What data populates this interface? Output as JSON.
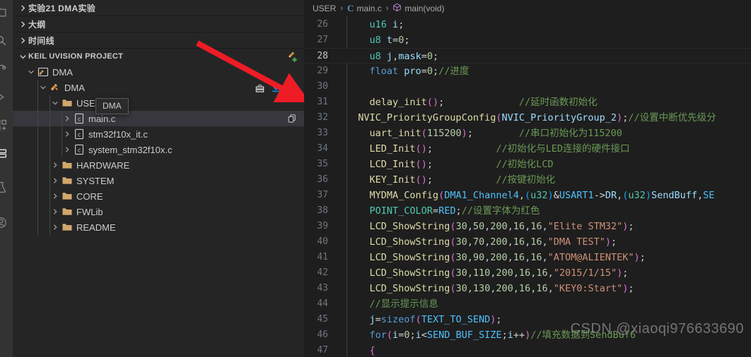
{
  "activity_bar": {
    "items": [
      {
        "name": "explorer-icon",
        "selected": false
      },
      {
        "name": "search-icon",
        "selected": false
      },
      {
        "name": "source-control-icon",
        "selected": false
      },
      {
        "name": "run-debug-icon",
        "selected": false
      },
      {
        "name": "extensions-icon",
        "selected": false
      },
      {
        "name": "remote-explorer-icon",
        "selected": true
      },
      {
        "name": "test-icon",
        "selected": false
      },
      {
        "name": "account-icon",
        "selected": false
      }
    ]
  },
  "sidebar": {
    "sections": [
      {
        "label": "实验21 DMA实验",
        "expanded": false,
        "cjk": true
      },
      {
        "label": "大纲",
        "expanded": false,
        "cjk": true
      },
      {
        "label": "时间线",
        "expanded": false,
        "cjk": true
      },
      {
        "label": "KEIL UVISION PROJECT",
        "expanded": true,
        "cjk": false,
        "action": "add-project-icon"
      }
    ],
    "tree": [
      {
        "label": "DMA",
        "depth": 0,
        "kind": "workspace",
        "expanded": true,
        "selected": false
      },
      {
        "label": "DMA",
        "depth": 1,
        "kind": "project",
        "expanded": true,
        "selected": false,
        "actions": [
          "build-icon",
          "download-icon",
          "rebuild-icon"
        ]
      },
      {
        "label": "USER",
        "depth": 2,
        "kind": "folder",
        "expanded": true,
        "selected": false
      },
      {
        "label": "main.c",
        "depth": 3,
        "kind": "cfile",
        "expanded": false,
        "selected": true,
        "row_action": "copy-icon"
      },
      {
        "label": "stm32f10x_it.c",
        "depth": 3,
        "kind": "cfile",
        "expanded": false,
        "selected": false
      },
      {
        "label": "system_stm32f10x.c",
        "depth": 3,
        "kind": "cfile",
        "expanded": false,
        "selected": false
      },
      {
        "label": "HARDWARE",
        "depth": 2,
        "kind": "folder",
        "expanded": false,
        "selected": false
      },
      {
        "label": "SYSTEM",
        "depth": 2,
        "kind": "folder",
        "expanded": false,
        "selected": false
      },
      {
        "label": "CORE",
        "depth": 2,
        "kind": "folder",
        "expanded": false,
        "selected": false
      },
      {
        "label": "FWLib",
        "depth": 2,
        "kind": "folder",
        "expanded": false,
        "selected": false
      },
      {
        "label": "README",
        "depth": 2,
        "kind": "folder",
        "expanded": false,
        "selected": false
      }
    ],
    "tooltip": "DMA"
  },
  "breadcrumb": {
    "folder": "USER",
    "file": "main.c",
    "symbol": "main(void)",
    "separator": "›"
  },
  "editor": {
    "first_line": 26,
    "current_line": 28,
    "lines": [
      {
        "n": "26",
        "tokens": [
          {
            "t": "    ",
            "c": "t-op"
          },
          {
            "t": "u16",
            "c": "t-type"
          },
          {
            "t": " ",
            "c": "t-op"
          },
          {
            "t": "i",
            "c": "t-var"
          },
          {
            "t": ";",
            "c": "t-punc"
          }
        ]
      },
      {
        "n": "27",
        "tokens": [
          {
            "t": "    ",
            "c": "t-op"
          },
          {
            "t": "u8",
            "c": "t-type"
          },
          {
            "t": " ",
            "c": "t-op"
          },
          {
            "t": "t",
            "c": "t-var"
          },
          {
            "t": "=",
            "c": "t-op"
          },
          {
            "t": "0",
            "c": "t-num"
          },
          {
            "t": ";",
            "c": "t-punc"
          }
        ]
      },
      {
        "n": "28",
        "tokens": [
          {
            "t": "    ",
            "c": "t-op"
          },
          {
            "t": "u8",
            "c": "t-type"
          },
          {
            "t": " ",
            "c": "t-op"
          },
          {
            "t": "j",
            "c": "t-var"
          },
          {
            "t": ",",
            "c": "t-punc"
          },
          {
            "t": "mask",
            "c": "t-var"
          },
          {
            "t": "=",
            "c": "t-op"
          },
          {
            "t": "0",
            "c": "t-num"
          },
          {
            "t": ";",
            "c": "t-punc"
          }
        ]
      },
      {
        "n": "29",
        "tokens": [
          {
            "t": "    ",
            "c": "t-op"
          },
          {
            "t": "float",
            "c": "t-kw"
          },
          {
            "t": " ",
            "c": "t-op"
          },
          {
            "t": "pro",
            "c": "t-var"
          },
          {
            "t": "=",
            "c": "t-op"
          },
          {
            "t": "0",
            "c": "t-num"
          },
          {
            "t": ";",
            "c": "t-punc"
          },
          {
            "t": "//进度",
            "c": "t-cmt"
          }
        ]
      },
      {
        "n": "30",
        "tokens": [
          {
            "t": "",
            "c": "t-op"
          }
        ]
      },
      {
        "n": "31",
        "tokens": [
          {
            "t": "    ",
            "c": "t-op"
          },
          {
            "t": "delay_init",
            "c": "t-fn"
          },
          {
            "t": "(",
            "c": "t-paren"
          },
          {
            "t": ")",
            "c": "t-paren"
          },
          {
            "t": ";",
            "c": "t-punc"
          },
          {
            "t": "             //延时函数初始化",
            "c": "t-cmt"
          }
        ]
      },
      {
        "n": "32",
        "tokens": [
          {
            "t": "  ",
            "c": "t-op"
          },
          {
            "t": "NVIC_PriorityGroupConfig",
            "c": "t-fn"
          },
          {
            "t": "(",
            "c": "t-paren"
          },
          {
            "t": "NVIC_PriorityGroup_2",
            "c": "t-var"
          },
          {
            "t": ")",
            "c": "t-paren"
          },
          {
            "t": ";",
            "c": "t-punc"
          },
          {
            "t": "//设置中断优先级分",
            "c": "t-cmt"
          }
        ]
      },
      {
        "n": "33",
        "tokens": [
          {
            "t": "    ",
            "c": "t-op"
          },
          {
            "t": "uart_init",
            "c": "t-fn"
          },
          {
            "t": "(",
            "c": "t-paren"
          },
          {
            "t": "115200",
            "c": "t-num"
          },
          {
            "t": ")",
            "c": "t-paren"
          },
          {
            "t": ";",
            "c": "t-punc"
          },
          {
            "t": "        //串口初始化为115200",
            "c": "t-cmt"
          }
        ]
      },
      {
        "n": "34",
        "tokens": [
          {
            "t": "    ",
            "c": "t-op"
          },
          {
            "t": "LED_Init",
            "c": "t-fn"
          },
          {
            "t": "(",
            "c": "t-paren"
          },
          {
            "t": ")",
            "c": "t-paren"
          },
          {
            "t": ";",
            "c": "t-punc"
          },
          {
            "t": "           //初始化与LED连接的硬件接口",
            "c": "t-cmt"
          }
        ]
      },
      {
        "n": "35",
        "tokens": [
          {
            "t": "    ",
            "c": "t-op"
          },
          {
            "t": "LCD_Init",
            "c": "t-fn"
          },
          {
            "t": "(",
            "c": "t-paren"
          },
          {
            "t": ")",
            "c": "t-paren"
          },
          {
            "t": ";",
            "c": "t-punc"
          },
          {
            "t": "           //初始化LCD",
            "c": "t-cmt"
          }
        ]
      },
      {
        "n": "36",
        "tokens": [
          {
            "t": "    ",
            "c": "t-op"
          },
          {
            "t": "KEY_Init",
            "c": "t-fn"
          },
          {
            "t": "(",
            "c": "t-paren"
          },
          {
            "t": ")",
            "c": "t-paren"
          },
          {
            "t": ";",
            "c": "t-punc"
          },
          {
            "t": "           //按键初始化",
            "c": "t-cmt"
          }
        ]
      },
      {
        "n": "37",
        "tokens": [
          {
            "t": "    ",
            "c": "t-op"
          },
          {
            "t": "MYDMA_Config",
            "c": "t-fn"
          },
          {
            "t": "(",
            "c": "t-paren"
          },
          {
            "t": "DMA1_Channel4",
            "c": "t-const"
          },
          {
            "t": ",",
            "c": "t-punc"
          },
          {
            "t": "(",
            "c": "t-paren2"
          },
          {
            "t": "u32",
            "c": "t-type"
          },
          {
            "t": ")",
            "c": "t-paren2"
          },
          {
            "t": "&",
            "c": "t-op"
          },
          {
            "t": "USART1",
            "c": "t-const"
          },
          {
            "t": "->",
            "c": "t-op"
          },
          {
            "t": "DR",
            "c": "t-var"
          },
          {
            "t": ",",
            "c": "t-punc"
          },
          {
            "t": "(",
            "c": "t-paren2"
          },
          {
            "t": "u32",
            "c": "t-type"
          },
          {
            "t": ")",
            "c": "t-paren2"
          },
          {
            "t": "SendBuff",
            "c": "t-var"
          },
          {
            "t": ",",
            "c": "t-punc"
          },
          {
            "t": "SE",
            "c": "t-const"
          }
        ]
      },
      {
        "n": "38",
        "tokens": [
          {
            "t": "    ",
            "c": "t-op"
          },
          {
            "t": "POINT_COLOR",
            "c": "t-type"
          },
          {
            "t": "=",
            "c": "t-op"
          },
          {
            "t": "RED",
            "c": "t-const"
          },
          {
            "t": ";",
            "c": "t-punc"
          },
          {
            "t": "//设置字体为红色",
            "c": "t-cmt"
          }
        ]
      },
      {
        "n": "39",
        "tokens": [
          {
            "t": "    ",
            "c": "t-op"
          },
          {
            "t": "LCD_ShowString",
            "c": "t-fn"
          },
          {
            "t": "(",
            "c": "t-paren"
          },
          {
            "t": "30",
            "c": "t-num"
          },
          {
            "t": ",",
            "c": "t-punc"
          },
          {
            "t": "50",
            "c": "t-num"
          },
          {
            "t": ",",
            "c": "t-punc"
          },
          {
            "t": "200",
            "c": "t-num"
          },
          {
            "t": ",",
            "c": "t-punc"
          },
          {
            "t": "16",
            "c": "t-num"
          },
          {
            "t": ",",
            "c": "t-punc"
          },
          {
            "t": "16",
            "c": "t-num"
          },
          {
            "t": ",",
            "c": "t-punc"
          },
          {
            "t": "\"Elite STM32\"",
            "c": "t-str"
          },
          {
            "t": ")",
            "c": "t-paren"
          },
          {
            "t": ";",
            "c": "t-punc"
          }
        ]
      },
      {
        "n": "40",
        "tokens": [
          {
            "t": "    ",
            "c": "t-op"
          },
          {
            "t": "LCD_ShowString",
            "c": "t-fn"
          },
          {
            "t": "(",
            "c": "t-paren"
          },
          {
            "t": "30",
            "c": "t-num"
          },
          {
            "t": ",",
            "c": "t-punc"
          },
          {
            "t": "70",
            "c": "t-num"
          },
          {
            "t": ",",
            "c": "t-punc"
          },
          {
            "t": "200",
            "c": "t-num"
          },
          {
            "t": ",",
            "c": "t-punc"
          },
          {
            "t": "16",
            "c": "t-num"
          },
          {
            "t": ",",
            "c": "t-punc"
          },
          {
            "t": "16",
            "c": "t-num"
          },
          {
            "t": ",",
            "c": "t-punc"
          },
          {
            "t": "\"DMA TEST\"",
            "c": "t-str"
          },
          {
            "t": ")",
            "c": "t-paren"
          },
          {
            "t": ";",
            "c": "t-punc"
          }
        ]
      },
      {
        "n": "41",
        "tokens": [
          {
            "t": "    ",
            "c": "t-op"
          },
          {
            "t": "LCD_ShowString",
            "c": "t-fn"
          },
          {
            "t": "(",
            "c": "t-paren"
          },
          {
            "t": "30",
            "c": "t-num"
          },
          {
            "t": ",",
            "c": "t-punc"
          },
          {
            "t": "90",
            "c": "t-num"
          },
          {
            "t": ",",
            "c": "t-punc"
          },
          {
            "t": "200",
            "c": "t-num"
          },
          {
            "t": ",",
            "c": "t-punc"
          },
          {
            "t": "16",
            "c": "t-num"
          },
          {
            "t": ",",
            "c": "t-punc"
          },
          {
            "t": "16",
            "c": "t-num"
          },
          {
            "t": ",",
            "c": "t-punc"
          },
          {
            "t": "\"ATOM@ALIENTEK\"",
            "c": "t-str"
          },
          {
            "t": ")",
            "c": "t-paren"
          },
          {
            "t": ";",
            "c": "t-punc"
          }
        ]
      },
      {
        "n": "42",
        "tokens": [
          {
            "t": "    ",
            "c": "t-op"
          },
          {
            "t": "LCD_ShowString",
            "c": "t-fn"
          },
          {
            "t": "(",
            "c": "t-paren"
          },
          {
            "t": "30",
            "c": "t-num"
          },
          {
            "t": ",",
            "c": "t-punc"
          },
          {
            "t": "110",
            "c": "t-num"
          },
          {
            "t": ",",
            "c": "t-punc"
          },
          {
            "t": "200",
            "c": "t-num"
          },
          {
            "t": ",",
            "c": "t-punc"
          },
          {
            "t": "16",
            "c": "t-num"
          },
          {
            "t": ",",
            "c": "t-punc"
          },
          {
            "t": "16",
            "c": "t-num"
          },
          {
            "t": ",",
            "c": "t-punc"
          },
          {
            "t": "\"2015/1/15\"",
            "c": "t-str"
          },
          {
            "t": ")",
            "c": "t-paren"
          },
          {
            "t": ";",
            "c": "t-punc"
          }
        ]
      },
      {
        "n": "43",
        "tokens": [
          {
            "t": "    ",
            "c": "t-op"
          },
          {
            "t": "LCD_ShowString",
            "c": "t-fn"
          },
          {
            "t": "(",
            "c": "t-paren"
          },
          {
            "t": "30",
            "c": "t-num"
          },
          {
            "t": ",",
            "c": "t-punc"
          },
          {
            "t": "130",
            "c": "t-num"
          },
          {
            "t": ",",
            "c": "t-punc"
          },
          {
            "t": "200",
            "c": "t-num"
          },
          {
            "t": ",",
            "c": "t-punc"
          },
          {
            "t": "16",
            "c": "t-num"
          },
          {
            "t": ",",
            "c": "t-punc"
          },
          {
            "t": "16",
            "c": "t-num"
          },
          {
            "t": ",",
            "c": "t-punc"
          },
          {
            "t": "\"KEY0:Start\"",
            "c": "t-str"
          },
          {
            "t": ")",
            "c": "t-paren"
          },
          {
            "t": ";",
            "c": "t-punc"
          }
        ]
      },
      {
        "n": "44",
        "tokens": [
          {
            "t": "    ",
            "c": "t-op"
          },
          {
            "t": "//显示提示信息",
            "c": "t-cmt"
          }
        ]
      },
      {
        "n": "45",
        "tokens": [
          {
            "t": "    ",
            "c": "t-op"
          },
          {
            "t": "j",
            "c": "t-var"
          },
          {
            "t": "=",
            "c": "t-op"
          },
          {
            "t": "sizeof",
            "c": "t-kw"
          },
          {
            "t": "(",
            "c": "t-paren"
          },
          {
            "t": "TEXT_TO_SEND",
            "c": "t-const"
          },
          {
            "t": ")",
            "c": "t-paren"
          },
          {
            "t": ";",
            "c": "t-punc"
          }
        ]
      },
      {
        "n": "46",
        "tokens": [
          {
            "t": "    ",
            "c": "t-op"
          },
          {
            "t": "for",
            "c": "t-kw"
          },
          {
            "t": "(",
            "c": "t-paren"
          },
          {
            "t": "i",
            "c": "t-var"
          },
          {
            "t": "=",
            "c": "t-op"
          },
          {
            "t": "0",
            "c": "t-num"
          },
          {
            "t": ";",
            "c": "t-punc"
          },
          {
            "t": "i",
            "c": "t-var"
          },
          {
            "t": "<",
            "c": "t-op"
          },
          {
            "t": "SEND_BUF_SIZE",
            "c": "t-const"
          },
          {
            "t": ";",
            "c": "t-punc"
          },
          {
            "t": "i",
            "c": "t-var"
          },
          {
            "t": "++",
            "c": "t-op"
          },
          {
            "t": ")",
            "c": "t-paren"
          },
          {
            "t": "//填充数据到SendBuf6",
            "c": "t-cmt"
          }
        ]
      },
      {
        "n": "47",
        "tokens": [
          {
            "t": "    ",
            "c": "t-op"
          },
          {
            "t": "{",
            "c": "t-paren"
          }
        ]
      }
    ]
  },
  "watermark": "CSDN @xiaoqi976633690",
  "colors": {
    "editor_bg": "#1e1e1e",
    "sidebar_bg": "#252526",
    "activity_bg": "#333333",
    "selection_bg": "#37373d",
    "folder_icon": "#dcb67a",
    "arrow_annotation": "#ee1c25",
    "accent_blue": "#0078d4"
  }
}
